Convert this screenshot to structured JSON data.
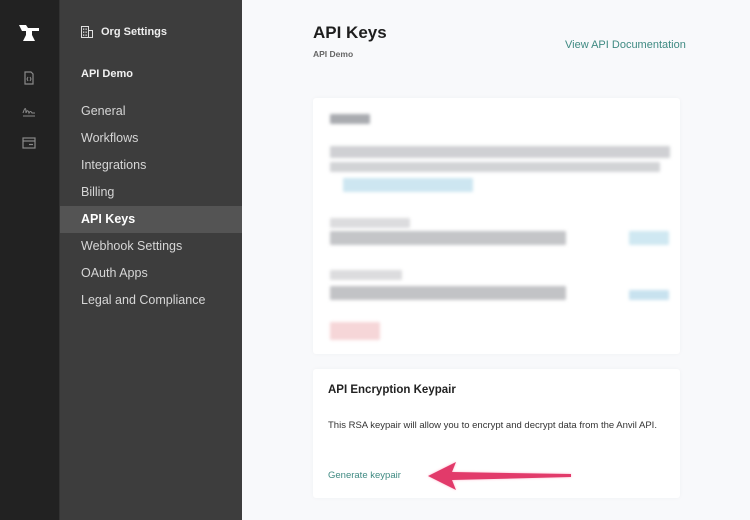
{
  "rail": {
    "logo": "anvil-logo",
    "icons": [
      "document-code-icon",
      "signature-icon",
      "browser-window-icon"
    ]
  },
  "sidebar": {
    "section_icon": "building-icon",
    "section_label": "Org Settings",
    "org_name": "API Demo",
    "items": [
      {
        "label": "General",
        "active": false
      },
      {
        "label": "Workflows",
        "active": false
      },
      {
        "label": "Integrations",
        "active": false
      },
      {
        "label": "Billing",
        "active": false
      },
      {
        "label": "API Keys",
        "active": true
      },
      {
        "label": "Webhook Settings",
        "active": false
      },
      {
        "label": "OAuth Apps",
        "active": false
      },
      {
        "label": "Legal and Compliance",
        "active": false
      }
    ]
  },
  "header": {
    "title": "API Keys",
    "subtitle": "API Demo",
    "doc_link": "View API Documentation"
  },
  "keys_card": {
    "redacted": true
  },
  "encryption_card": {
    "title": "API Encryption Keypair",
    "description": "This RSA keypair will allow you to encrypt and decrypt data from the Anvil API.",
    "action_label": "Generate keypair"
  },
  "annotation": {
    "type": "arrow",
    "color": "#e23a6a",
    "points_to": "Generate keypair"
  },
  "colors": {
    "rail_bg": "#222222",
    "sidebar_bg": "#3d3d3d",
    "sidebar_active_bg": "#545454",
    "link": "#3f8a82",
    "page_bg": "#f8f9fb"
  }
}
